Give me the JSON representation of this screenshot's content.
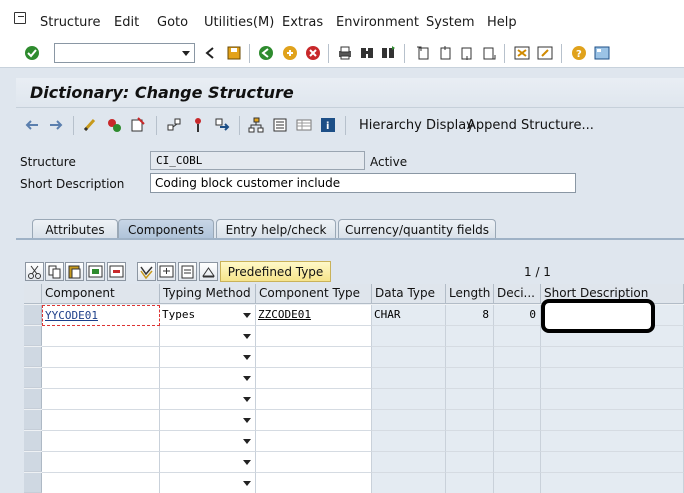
{
  "menubar": {
    "items": [
      "Structure",
      "Edit",
      "Goto",
      "Utilities(M)",
      "Extras",
      "Environment",
      "System",
      "Help"
    ]
  },
  "toolbar": {
    "command_field_value": "",
    "icons": [
      "enter-icon",
      "back-icon",
      "save-icon",
      "green-back-icon",
      "exit-icon",
      "cancel-icon",
      "print-icon",
      "find-icon",
      "find-next-icon",
      "first-page-icon",
      "prev-page-icon",
      "next-page-icon",
      "last-page-icon",
      "new-session-icon",
      "shortcut-icon",
      "help-icon",
      "layout-icon"
    ]
  },
  "title": "Dictionary: Change Structure",
  "app_toolbar": {
    "hierarchy_display": "Hierarchy Display",
    "append_structure": "Append Structure..."
  },
  "header": {
    "structure_label": "Structure",
    "structure_value": "CI_COBL",
    "status": "Active",
    "short_desc_label": "Short Description",
    "short_desc_value": "Coding block customer include"
  },
  "tabs": [
    "Attributes",
    "Components",
    "Entry help/check",
    "Currency/quantity fields"
  ],
  "active_tab": "Components",
  "table_toolbar": {
    "predefined_type_label": "Predefined Type",
    "pager": "1  /  1"
  },
  "grid": {
    "columns": [
      "Component",
      "Typing Method",
      "Component Type",
      "Data Type",
      "Length",
      "Deci...",
      "Short Description"
    ],
    "rows": [
      {
        "component": "YYCODE01",
        "typing_method": "Types",
        "component_type": "ZZCODE01",
        "data_type": "CHAR",
        "length": "8",
        "decimals": "0",
        "short_description": ""
      }
    ],
    "empty_rows": 8
  }
}
